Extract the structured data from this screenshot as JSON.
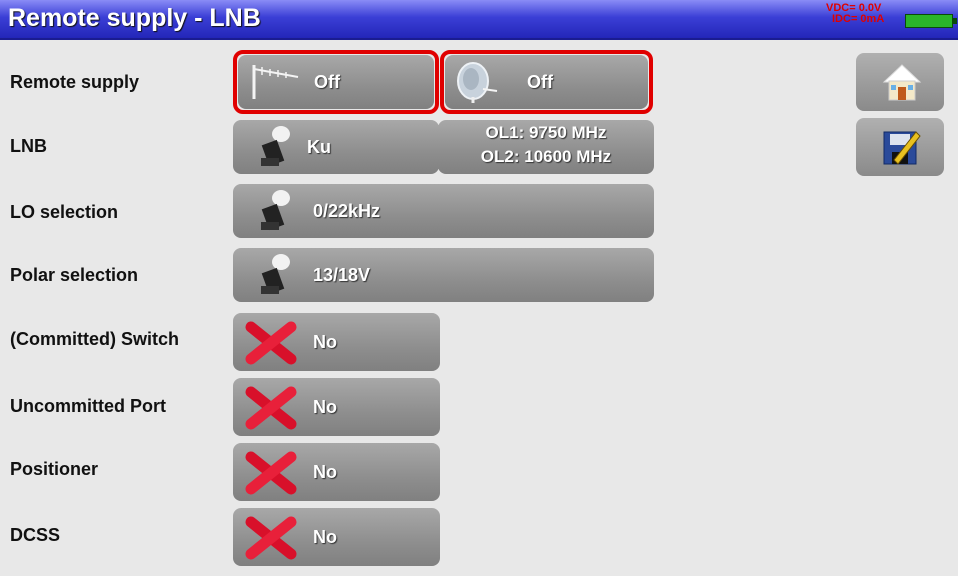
{
  "header": {
    "title": "Remote supply - LNB",
    "vdc": "VDC= 0.0V",
    "idc": "IDC= 0mA"
  },
  "rows": {
    "remote_supply": {
      "label": "Remote supply",
      "terrestrial": "Off",
      "satellite": "Off"
    },
    "lnb": {
      "label": "LNB",
      "value": "Ku",
      "ol1": "OL1: 9750 MHz",
      "ol2": "OL2: 10600 MHz"
    },
    "lo_selection": {
      "label": "LO selection",
      "value": "0/22kHz"
    },
    "polar_selection": {
      "label": "Polar selection",
      "value": "13/18V"
    },
    "committed_switch": {
      "label": "(Committed) Switch",
      "value": "No"
    },
    "uncommitted_port": {
      "label": "Uncommitted Port",
      "value": "No"
    },
    "positioner": {
      "label": "Positioner",
      "value": "No"
    },
    "dcss": {
      "label": "DCSS",
      "value": "No"
    }
  },
  "icons": {
    "home": "home-icon",
    "save": "save-edit-icon",
    "antenna": "antenna-icon",
    "dish": "dish-icon",
    "lnb": "lnb-icon",
    "disabled": "red-x-icon"
  },
  "colors": {
    "title_bar": "#2326b8",
    "highlight": "#e00000",
    "button": "#8e8e8e",
    "battery": "#2ab52a"
  }
}
